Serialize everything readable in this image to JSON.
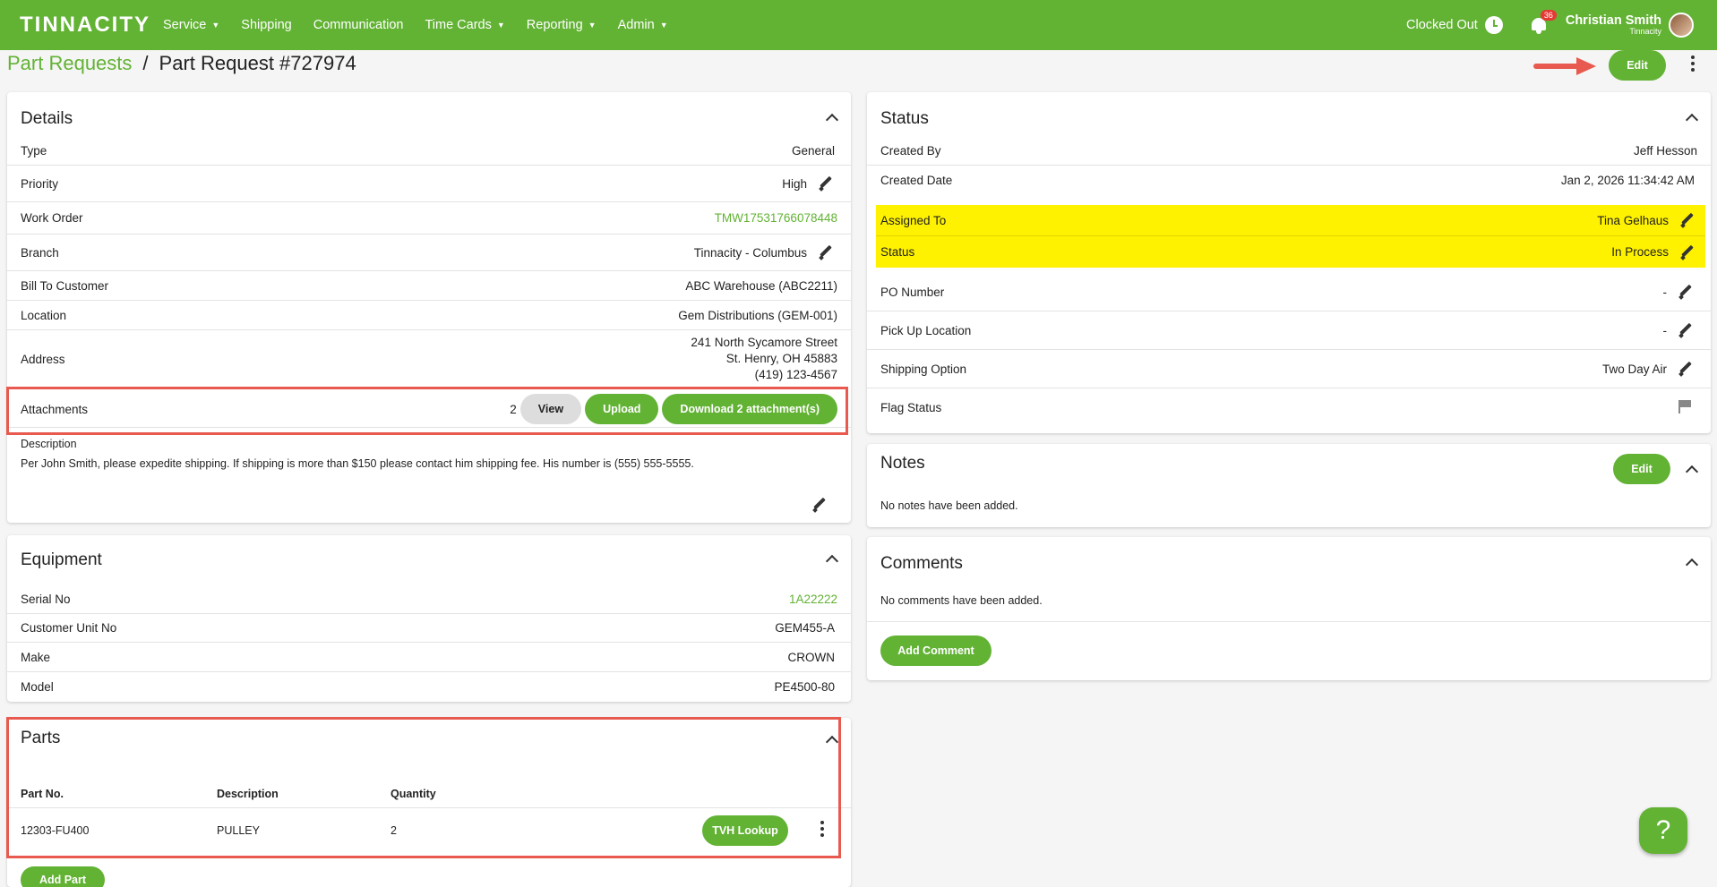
{
  "nav": {
    "logo": "TINNACITY",
    "items": [
      {
        "label": "Service",
        "caret": true
      },
      {
        "label": "Shipping",
        "caret": false
      },
      {
        "label": "Communication",
        "caret": false
      },
      {
        "label": "Time Cards",
        "caret": true
      },
      {
        "label": "Reporting",
        "caret": true
      },
      {
        "label": "Admin",
        "caret": true
      }
    ],
    "clock_status": "Clocked Out",
    "notification_count": "36",
    "user_name": "Christian Smith",
    "user_org": "Tinnacity"
  },
  "breadcrumb": {
    "parent": "Part Requests",
    "separator": "/",
    "current": "Part Request #727974"
  },
  "header_actions": {
    "edit_label": "Edit"
  },
  "details": {
    "title": "Details",
    "type_label": "Type",
    "type_value": "General",
    "priority_label": "Priority",
    "priority_value": "High",
    "work_order_label": "Work Order",
    "work_order_value": "TMW17531766078448",
    "branch_label": "Branch",
    "branch_value": "Tinnacity - Columbus",
    "bill_to_label": "Bill To Customer",
    "bill_to_value": "ABC Warehouse  (ABC2211)",
    "location_label": "Location",
    "location_value": "Gem Distributions  (GEM-001)",
    "address_label": "Address",
    "address_line1": "241 North Sycamore Street",
    "address_line2": "St. Henry, OH 45883",
    "address_line3": "(419) 123-4567",
    "attachments_label": "Attachments",
    "attachments_count": "2",
    "view_label": "View",
    "upload_label": "Upload",
    "download_label": "Download 2 attachment(s)",
    "description_label": "Description",
    "description_value": "Per John Smith, please expedite shipping. If shipping is more than $150 please contact him shipping fee.  His number is (555) 555-5555."
  },
  "equipment": {
    "title": "Equipment",
    "serial_label": "Serial No",
    "serial_value": "1A22222",
    "unit_label": "Customer Unit No",
    "unit_value": "GEM455-A",
    "make_label": "Make",
    "make_value": "CROWN",
    "model_label": "Model",
    "model_value": "PE4500-80"
  },
  "parts": {
    "title": "Parts",
    "columns": [
      "Part No.",
      "Description",
      "Quantity"
    ],
    "rows": [
      {
        "part_no": "12303-FU400",
        "description": "PULLEY",
        "quantity": "2"
      }
    ],
    "tvh_label": "TVH Lookup",
    "add_label": "Add Part"
  },
  "status": {
    "title": "Status",
    "created_by_label": "Created By",
    "created_by_value": "Jeff Hesson",
    "created_date_label": "Created Date",
    "created_date_value": "Jan 2, 2026 11:34:42 AM",
    "assigned_label": "Assigned To",
    "assigned_value": "Tina Gelhaus",
    "status_label": "Status",
    "status_value": "In Process",
    "po_label": "PO Number",
    "po_value": "-",
    "pickup_label": "Pick Up Location",
    "pickup_value": "-",
    "shipping_label": "Shipping Option",
    "shipping_value": "Two Day Air",
    "flag_label": "Flag Status"
  },
  "notes": {
    "title": "Notes",
    "edit_label": "Edit",
    "empty": "No notes have been added."
  },
  "comments": {
    "title": "Comments",
    "empty": "No comments have been added.",
    "add_label": "Add Comment"
  },
  "help": {
    "glyph": "?"
  },
  "colors": {
    "brand": "#62b234",
    "highlight": "#fff200",
    "annotation": "#e85a4f"
  }
}
